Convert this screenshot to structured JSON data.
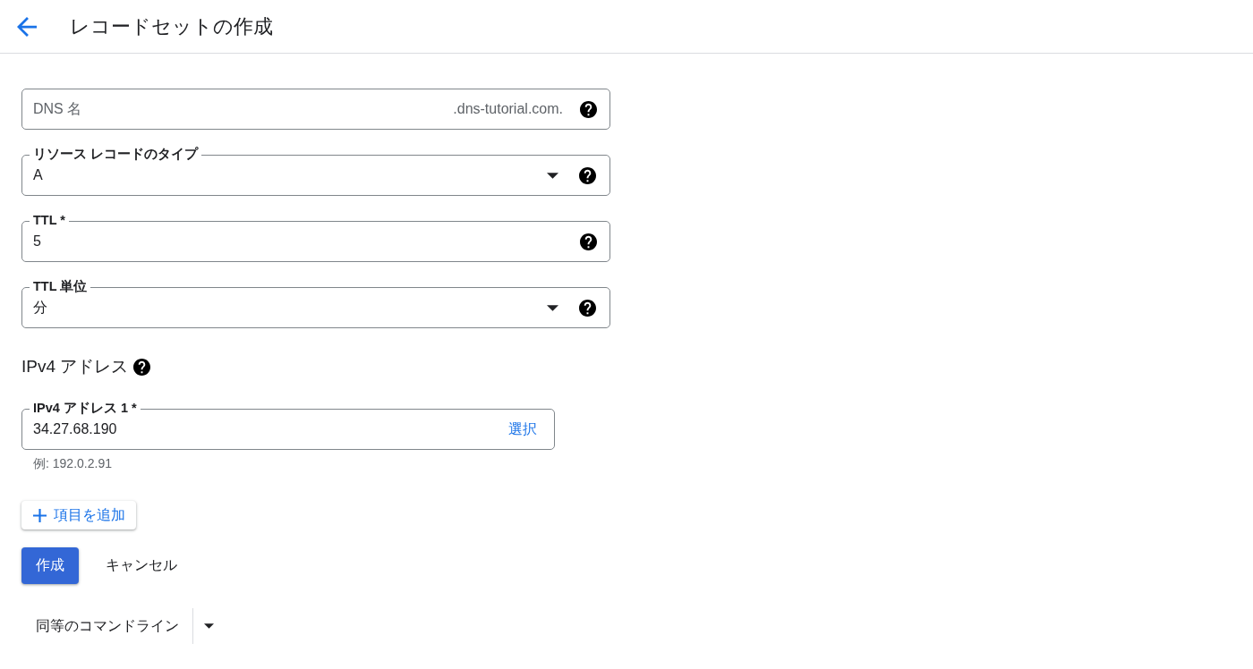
{
  "header": {
    "title": "レコードセットの作成"
  },
  "fields": [
    {
      "kind": "text",
      "placeholder": "DNS 名",
      "suffix": ".dns-tutorial.com."
    },
    {
      "kind": "select",
      "label": "リソース レコードのタイプ",
      "value": "A"
    },
    {
      "kind": "text",
      "label": "TTL *",
      "value": "5"
    },
    {
      "kind": "select",
      "label": "TTL 単位",
      "value": "分"
    }
  ],
  "ipv4": {
    "heading": "IPv4 アドレス",
    "entries": [
      {
        "label": "IPv4 アドレス 1 *",
        "value": "34.27.68.190",
        "action": "選択",
        "hint": "例: 192.0.2.91"
      }
    ],
    "add_button": "項目を追加"
  },
  "actions": {
    "create": "作成",
    "cancel": "キャンセル"
  },
  "command_line": {
    "label": "同等のコマンドライン"
  }
}
